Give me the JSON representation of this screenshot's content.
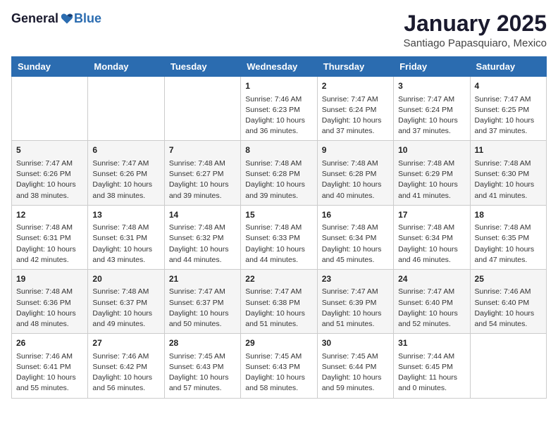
{
  "header": {
    "logo_general": "General",
    "logo_blue": "Blue",
    "month_title": "January 2025",
    "subtitle": "Santiago Papasquiaro, Mexico"
  },
  "days_of_week": [
    "Sunday",
    "Monday",
    "Tuesday",
    "Wednesday",
    "Thursday",
    "Friday",
    "Saturday"
  ],
  "weeks": [
    [
      {
        "day": "",
        "info": ""
      },
      {
        "day": "",
        "info": ""
      },
      {
        "day": "",
        "info": ""
      },
      {
        "day": "1",
        "info": "Sunrise: 7:46 AM\nSunset: 6:23 PM\nDaylight: 10 hours\nand 36 minutes."
      },
      {
        "day": "2",
        "info": "Sunrise: 7:47 AM\nSunset: 6:24 PM\nDaylight: 10 hours\nand 37 minutes."
      },
      {
        "day": "3",
        "info": "Sunrise: 7:47 AM\nSunset: 6:24 PM\nDaylight: 10 hours\nand 37 minutes."
      },
      {
        "day": "4",
        "info": "Sunrise: 7:47 AM\nSunset: 6:25 PM\nDaylight: 10 hours\nand 37 minutes."
      }
    ],
    [
      {
        "day": "5",
        "info": "Sunrise: 7:47 AM\nSunset: 6:26 PM\nDaylight: 10 hours\nand 38 minutes."
      },
      {
        "day": "6",
        "info": "Sunrise: 7:47 AM\nSunset: 6:26 PM\nDaylight: 10 hours\nand 38 minutes."
      },
      {
        "day": "7",
        "info": "Sunrise: 7:48 AM\nSunset: 6:27 PM\nDaylight: 10 hours\nand 39 minutes."
      },
      {
        "day": "8",
        "info": "Sunrise: 7:48 AM\nSunset: 6:28 PM\nDaylight: 10 hours\nand 39 minutes."
      },
      {
        "day": "9",
        "info": "Sunrise: 7:48 AM\nSunset: 6:28 PM\nDaylight: 10 hours\nand 40 minutes."
      },
      {
        "day": "10",
        "info": "Sunrise: 7:48 AM\nSunset: 6:29 PM\nDaylight: 10 hours\nand 41 minutes."
      },
      {
        "day": "11",
        "info": "Sunrise: 7:48 AM\nSunset: 6:30 PM\nDaylight: 10 hours\nand 41 minutes."
      }
    ],
    [
      {
        "day": "12",
        "info": "Sunrise: 7:48 AM\nSunset: 6:31 PM\nDaylight: 10 hours\nand 42 minutes."
      },
      {
        "day": "13",
        "info": "Sunrise: 7:48 AM\nSunset: 6:31 PM\nDaylight: 10 hours\nand 43 minutes."
      },
      {
        "day": "14",
        "info": "Sunrise: 7:48 AM\nSunset: 6:32 PM\nDaylight: 10 hours\nand 44 minutes."
      },
      {
        "day": "15",
        "info": "Sunrise: 7:48 AM\nSunset: 6:33 PM\nDaylight: 10 hours\nand 44 minutes."
      },
      {
        "day": "16",
        "info": "Sunrise: 7:48 AM\nSunset: 6:34 PM\nDaylight: 10 hours\nand 45 minutes."
      },
      {
        "day": "17",
        "info": "Sunrise: 7:48 AM\nSunset: 6:34 PM\nDaylight: 10 hours\nand 46 minutes."
      },
      {
        "day": "18",
        "info": "Sunrise: 7:48 AM\nSunset: 6:35 PM\nDaylight: 10 hours\nand 47 minutes."
      }
    ],
    [
      {
        "day": "19",
        "info": "Sunrise: 7:48 AM\nSunset: 6:36 PM\nDaylight: 10 hours\nand 48 minutes."
      },
      {
        "day": "20",
        "info": "Sunrise: 7:48 AM\nSunset: 6:37 PM\nDaylight: 10 hours\nand 49 minutes."
      },
      {
        "day": "21",
        "info": "Sunrise: 7:47 AM\nSunset: 6:37 PM\nDaylight: 10 hours\nand 50 minutes."
      },
      {
        "day": "22",
        "info": "Sunrise: 7:47 AM\nSunset: 6:38 PM\nDaylight: 10 hours\nand 51 minutes."
      },
      {
        "day": "23",
        "info": "Sunrise: 7:47 AM\nSunset: 6:39 PM\nDaylight: 10 hours\nand 51 minutes."
      },
      {
        "day": "24",
        "info": "Sunrise: 7:47 AM\nSunset: 6:40 PM\nDaylight: 10 hours\nand 52 minutes."
      },
      {
        "day": "25",
        "info": "Sunrise: 7:46 AM\nSunset: 6:40 PM\nDaylight: 10 hours\nand 54 minutes."
      }
    ],
    [
      {
        "day": "26",
        "info": "Sunrise: 7:46 AM\nSunset: 6:41 PM\nDaylight: 10 hours\nand 55 minutes."
      },
      {
        "day": "27",
        "info": "Sunrise: 7:46 AM\nSunset: 6:42 PM\nDaylight: 10 hours\nand 56 minutes."
      },
      {
        "day": "28",
        "info": "Sunrise: 7:45 AM\nSunset: 6:43 PM\nDaylight: 10 hours\nand 57 minutes."
      },
      {
        "day": "29",
        "info": "Sunrise: 7:45 AM\nSunset: 6:43 PM\nDaylight: 10 hours\nand 58 minutes."
      },
      {
        "day": "30",
        "info": "Sunrise: 7:45 AM\nSunset: 6:44 PM\nDaylight: 10 hours\nand 59 minutes."
      },
      {
        "day": "31",
        "info": "Sunrise: 7:44 AM\nSunset: 6:45 PM\nDaylight: 11 hours\nand 0 minutes."
      },
      {
        "day": "",
        "info": ""
      }
    ]
  ]
}
